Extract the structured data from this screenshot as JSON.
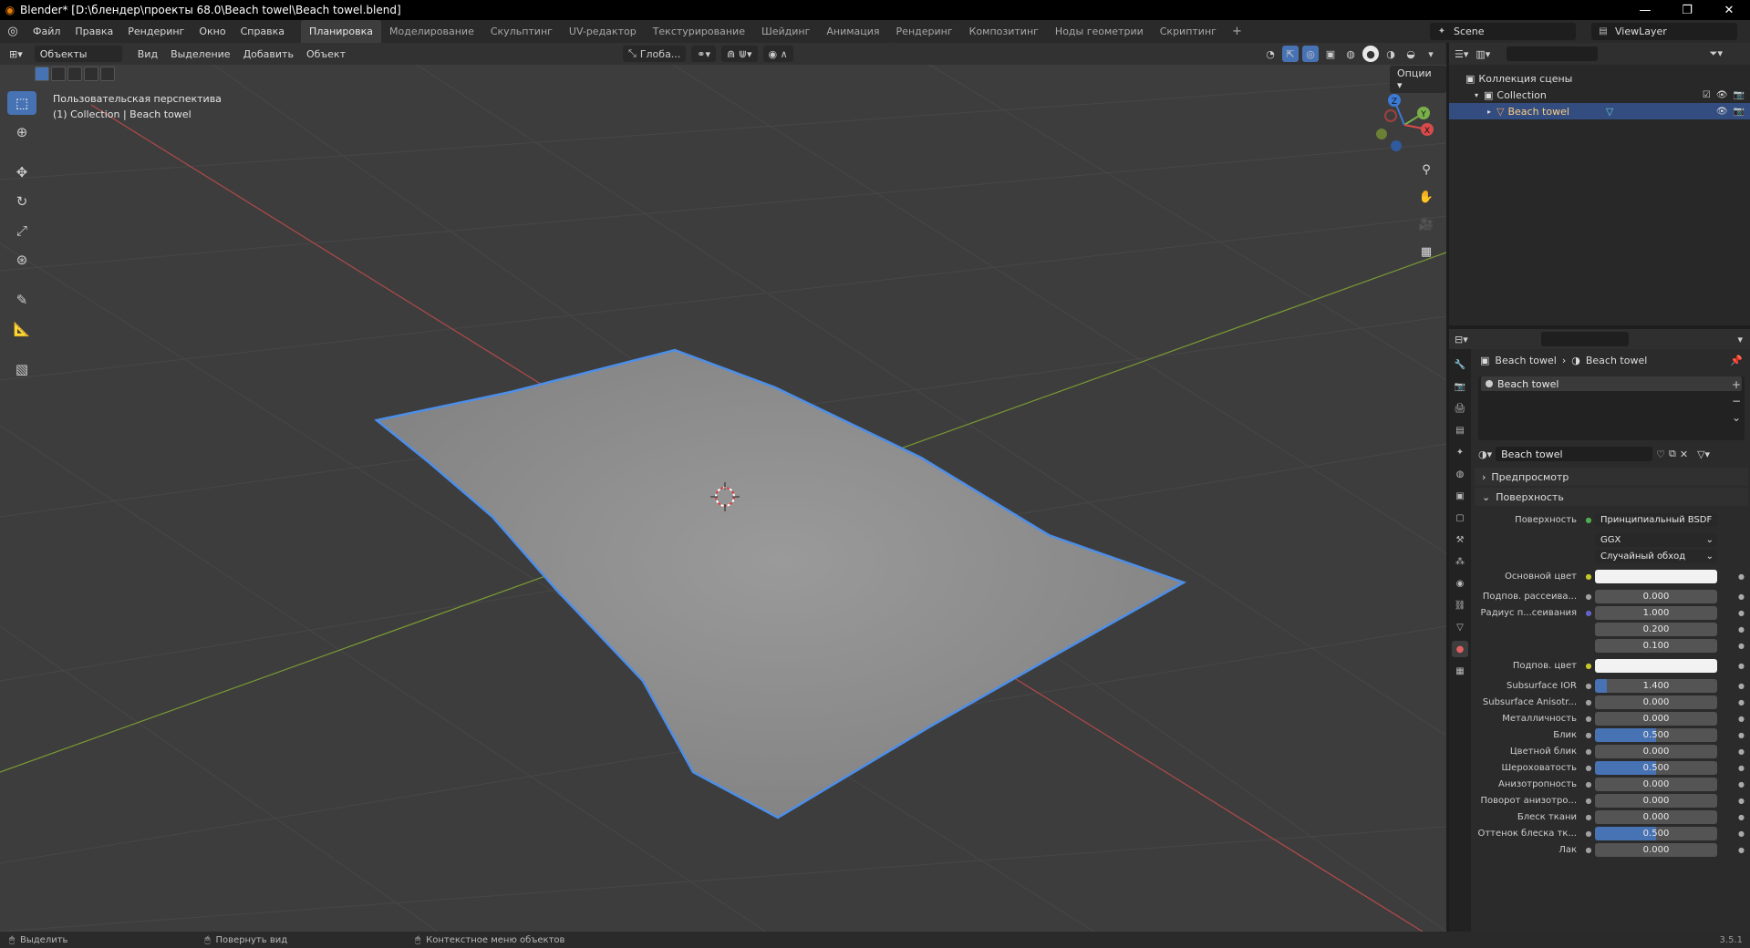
{
  "window": {
    "title": "Blender* [D:\\блендер\\проекты 68.0\\Beach towel\\Beach towel.blend]",
    "minimize": "—",
    "maximize": "❐",
    "close": "✕"
  },
  "menu": [
    "Файл",
    "Правка",
    "Рендеринг",
    "Окно",
    "Справка"
  ],
  "workspaces": [
    "Планировка",
    "Моделирование",
    "Скульптинг",
    "UV-редактор",
    "Текстурирование",
    "Шейдинг",
    "Анимация",
    "Рендеринг",
    "Композитинг",
    "Ноды геометрии",
    "Скриптинг"
  ],
  "workspace_add": "+",
  "scene_name": "Scene",
  "view_layer": "ViewLayer",
  "viewport": {
    "mode": "Объекты",
    "menus": [
      "Вид",
      "Выделение",
      "Добавить",
      "Объект"
    ],
    "orientation": "Глоба...",
    "options": "Опции",
    "perspective_label": "Пользовательская перспектива",
    "collection_label": "(1) Collection | Beach towel"
  },
  "outliner": {
    "scene_collection": "Коллекция сцены",
    "collection": "Collection",
    "object": "Beach towel"
  },
  "properties": {
    "object_name": "Beach towel",
    "material_name": "Beach towel",
    "panel_preview": "Предпросмотр",
    "panel_surface": "Поверхность",
    "surface_label": "Поверхность",
    "surface_value": "Принципиальный BSDF",
    "distribution": "GGX",
    "subsurface_method": "Случайный обход",
    "rows": [
      {
        "label": "Основной цвет",
        "value": "",
        "kind": "color",
        "sock": "#c7c729"
      },
      {
        "label": "Подпов. рассеива...",
        "value": "0.000",
        "kind": "num",
        "fill": 0,
        "sock": "#a1a1a1"
      },
      {
        "label": "Радиус п...сеивания",
        "value": "1.000",
        "kind": "num",
        "fill": 0,
        "sock": "#6363c7"
      },
      {
        "label": "",
        "value": "0.200",
        "kind": "num",
        "fill": 0,
        "sock": ""
      },
      {
        "label": "",
        "value": "0.100",
        "kind": "num",
        "fill": 0,
        "sock": ""
      },
      {
        "label": "Подпов. цвет",
        "value": "",
        "kind": "color",
        "sock": "#c7c729"
      },
      {
        "label": "Subsurface IOR",
        "value": "1.400",
        "kind": "num",
        "fill": 0.1,
        "sock": "#a1a1a1"
      },
      {
        "label": "Subsurface Anisotr...",
        "value": "0.000",
        "kind": "num",
        "fill": 0,
        "sock": "#a1a1a1"
      },
      {
        "label": "Металличность",
        "value": "0.000",
        "kind": "num",
        "fill": 0,
        "sock": "#a1a1a1"
      },
      {
        "label": "Блик",
        "value": "0.500",
        "kind": "num",
        "fill": 0.5,
        "sock": "#a1a1a1"
      },
      {
        "label": "Цветной блик",
        "value": "0.000",
        "kind": "num",
        "fill": 0,
        "sock": "#a1a1a1"
      },
      {
        "label": "Шероховатость",
        "value": "0.500",
        "kind": "num",
        "fill": 0.5,
        "sock": "#a1a1a1"
      },
      {
        "label": "Анизотропность",
        "value": "0.000",
        "kind": "num",
        "fill": 0,
        "sock": "#a1a1a1"
      },
      {
        "label": "Поворот анизотро...",
        "value": "0.000",
        "kind": "num",
        "fill": 0,
        "sock": "#a1a1a1"
      },
      {
        "label": "Блеск ткани",
        "value": "0.000",
        "kind": "num",
        "fill": 0,
        "sock": "#a1a1a1"
      },
      {
        "label": "Оттенок блеска тк...",
        "value": "0.500",
        "kind": "num",
        "fill": 0.5,
        "sock": "#a1a1a1"
      },
      {
        "label": "Лак",
        "value": "0.000",
        "kind": "num",
        "fill": 0,
        "sock": "#a1a1a1"
      }
    ]
  },
  "status": {
    "select": "Выделить",
    "rotate": "Повернуть вид",
    "context": "Контекстное меню объектов",
    "version": "3.5.1"
  },
  "gizmo_labels": {
    "z": "Z",
    "y": "Y",
    "x": "X"
  },
  "colors": {
    "accent": "#4772b3",
    "selection_outline": "#4d8ee8",
    "x_axis": "#b34a4a",
    "y_axis": "#7a9a34"
  }
}
